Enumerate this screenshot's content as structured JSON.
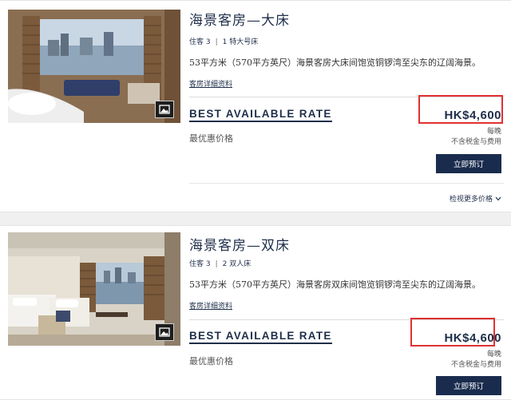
{
  "rooms": [
    {
      "title": "海景客房—大床",
      "occupancy_label": "住客 3",
      "bed_label": "1 特大号床",
      "description": "53平方米（570平方英尺）海景客房大床间饱览铜锣湾至尖东的辽阔海景。",
      "details_link": "客房详细资料",
      "rate_name": "BEST AVAILABLE RATE",
      "rate_sub": "最优惠价格",
      "price": "HK$4,600",
      "per_night": "每晚",
      "tax_note": "不含税金与费用",
      "book_label": "立即预订",
      "more_rates": "检视更多价格"
    },
    {
      "title": "海景客房—双床",
      "occupancy_label": "住客 3",
      "bed_label": "2 双人床",
      "description": "53平方米（570平方英尺）海景客房双床间饱览铜锣湾至尖东的辽阔海景。",
      "details_link": "客房详细资料",
      "rate_name": "BEST AVAILABLE RATE",
      "rate_sub": "最优惠价格",
      "price": "HK$4,600",
      "per_night": "每晚",
      "tax_note": "不含税金与费用",
      "book_label": "立即预订"
    }
  ],
  "colors": {
    "navy": "#1a2c4e",
    "highlight": "#e03131"
  },
  "icons": {
    "gallery": "gallery-icon",
    "chevron": "chevron-down-icon"
  }
}
